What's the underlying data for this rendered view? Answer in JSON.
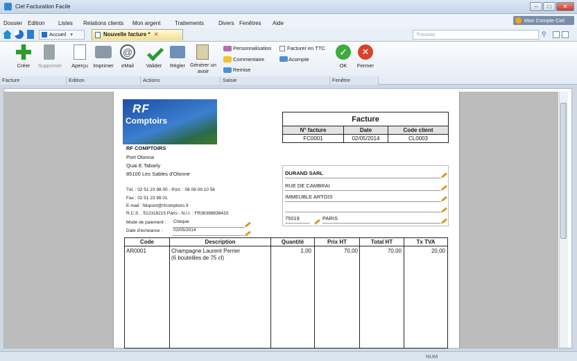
{
  "window": {
    "title": "Ciel Facturation Facile"
  },
  "menu": [
    "Dossier",
    "Edition",
    "Listes",
    "Relations clients",
    "Mon argent",
    "Traitements",
    "Divers",
    "Fenêtres",
    "Aide"
  ],
  "account": "Mon Compte Ciel",
  "tabs": {
    "home": "Accueil",
    "active": "Nouvelle facture *"
  },
  "search": {
    "placeholder": "Trouvoo"
  },
  "ribbon": {
    "facture": {
      "creer": "Créer",
      "supprimer": "Supprimer",
      "group": "Facture"
    },
    "edition": {
      "apercu": "Aperçu",
      "imprimer": "Imprimer",
      "email": "eMail",
      "group": "Edition"
    },
    "actions": {
      "valider": "Valider",
      "regler": "Régler",
      "generer": "Générer un",
      "generer2": "avoir",
      "group": "Actions"
    },
    "saisie": {
      "perso": "Personnalisation",
      "commentaire": "Commentaire",
      "remise": "Remise",
      "ttc": "Facturer en TTC",
      "acompte": "Acompte",
      "group": "Saisie"
    },
    "fenetre": {
      "ok": "OK",
      "fermer": "Fermer",
      "group": "Fenêtre"
    }
  },
  "logo": {
    "line1": "RF",
    "line2": "Comptoirs"
  },
  "company": {
    "name": "RF COMPTOIRS",
    "addr1": "Port Olonna",
    "addr2": "Quai E.Tabarly",
    "city": "85100 Les Sables d'Olonne",
    "tel": "Tél. : 02 51 23 98 00 - Port. : 06 08 09 10 56",
    "fax": "Fax : 02 51 23 98 01",
    "email": "E-mail : fdupont@rfcomptoirs.fr",
    "rcs": "R.C.S. : 512318215 Paris - N.I.I. : FR38398838433",
    "mode_label": "Mode de paiement :",
    "mode_value": "Chèque",
    "echeance_label": "Date d'échéance :",
    "echeance_value": "02/05/2014"
  },
  "invoice": {
    "title": "Facture",
    "col_num": "N° facture",
    "col_date": "Date",
    "col_client": "Code client",
    "num": "FC0001",
    "date": "02/05/2014",
    "client": "CL0003"
  },
  "customer": {
    "name": "DURAND SARL",
    "addr1": "RUE DE CAMBRAI",
    "addr2": "IMMEUBLE ARTOIS",
    "zip": "75019",
    "city": "PARIS"
  },
  "lines": {
    "headers": [
      "Code",
      "Description",
      "Quantité",
      "Prix HT",
      "Total HT",
      "Tx TVA"
    ],
    "rows": [
      {
        "code": "AR0001",
        "desc1": "Champagne Laurent Perrier",
        "desc2": "(6 bouteilles de 75 cl)",
        "qty": "1,00",
        "prix": "70,00",
        "total": "70,00",
        "tva": "20,00"
      }
    ]
  },
  "status": {
    "num": "NUM"
  }
}
